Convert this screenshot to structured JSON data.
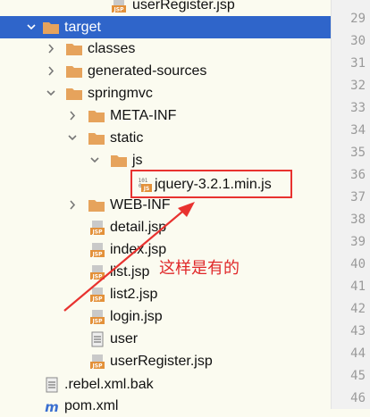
{
  "tree": {
    "items": [
      {
        "label": "userRegister.jsp",
        "icon": "jsp-file-icon"
      },
      {
        "label": "target",
        "icon": "folder-icon",
        "expanded": true,
        "selected": true
      },
      {
        "label": "classes",
        "icon": "folder-icon",
        "expanded": false
      },
      {
        "label": "generated-sources",
        "icon": "folder-icon",
        "expanded": false
      },
      {
        "label": "springmvc",
        "icon": "folder-icon",
        "expanded": true
      },
      {
        "label": "META-INF",
        "icon": "folder-icon",
        "expanded": false
      },
      {
        "label": "static",
        "icon": "folder-icon",
        "expanded": true
      },
      {
        "label": "js",
        "icon": "folder-icon",
        "expanded": true
      },
      {
        "label": "jquery-3.2.1.min.js",
        "icon": "js-file-icon"
      },
      {
        "label": "WEB-INF",
        "icon": "folder-icon",
        "expanded": false
      },
      {
        "label": "detail.jsp",
        "icon": "jsp-file-icon"
      },
      {
        "label": "index.jsp",
        "icon": "jsp-file-icon"
      },
      {
        "label": "list.jsp",
        "icon": "jsp-file-icon"
      },
      {
        "label": "list2.jsp",
        "icon": "jsp-file-icon"
      },
      {
        "label": "login.jsp",
        "icon": "jsp-file-icon"
      },
      {
        "label": "user",
        "icon": "text-file-icon"
      },
      {
        "label": "userRegister.jsp",
        "icon": "jsp-file-icon"
      },
      {
        "label": ".rebel.xml.bak",
        "icon": "text-file-icon"
      },
      {
        "label": "pom.xml",
        "icon": "maven-file-icon"
      }
    ]
  },
  "gutter": {
    "line_numbers": [
      "29",
      "30",
      "31",
      "32",
      "33",
      "34",
      "35",
      "36",
      "37",
      "38",
      "39",
      "40",
      "41",
      "42",
      "43",
      "44",
      "45",
      "46"
    ]
  },
  "annotation": {
    "note": "这样是有的",
    "color": "#e8322f"
  },
  "colors": {
    "selection": "#2f65ca",
    "folder": "#e6a35c",
    "jsp_badge": "#e3913a",
    "background": "#fbfbf0"
  }
}
